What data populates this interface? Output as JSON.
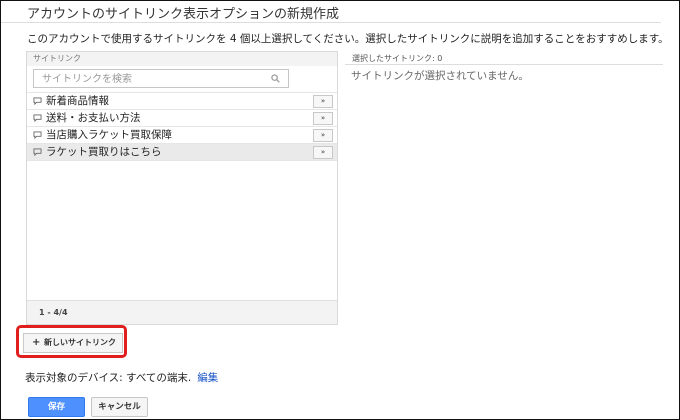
{
  "dialog": {
    "title": "アカウントのサイトリンク表示オプションの新規作成",
    "instruction": "このアカウントで使用するサイトリンクを 4 個以上選択してください。選択したサイトリンクに説明を追加することをおすすめします。"
  },
  "left_panel": {
    "header": "サイトリンク",
    "search_placeholder": "サイトリンクを検索",
    "items": [
      {
        "label": "新着商品情報",
        "button": "»"
      },
      {
        "label": "送料・お支払い方法",
        "button": "»"
      },
      {
        "label": "当店購入ラケット買取保障",
        "button": "»"
      },
      {
        "label": "ラケット買取りはこちら",
        "button": "»"
      }
    ],
    "pagination": "1 - 4/4"
  },
  "right_panel": {
    "header": "選択したサイトリンク: 0",
    "empty_message": "サイトリンクが選択されていません。"
  },
  "new_sitelink": {
    "plus": "+",
    "label": "新しいサイトリンク"
  },
  "device": {
    "label": "表示対象のデバイス: すべての端末.",
    "edit": "編集"
  },
  "actions": {
    "save": "保存",
    "cancel": "キャンセル"
  },
  "colors": {
    "primary": "#4d90fe",
    "link": "#1a55c8",
    "highlight_ring": "#e01e1e"
  }
}
